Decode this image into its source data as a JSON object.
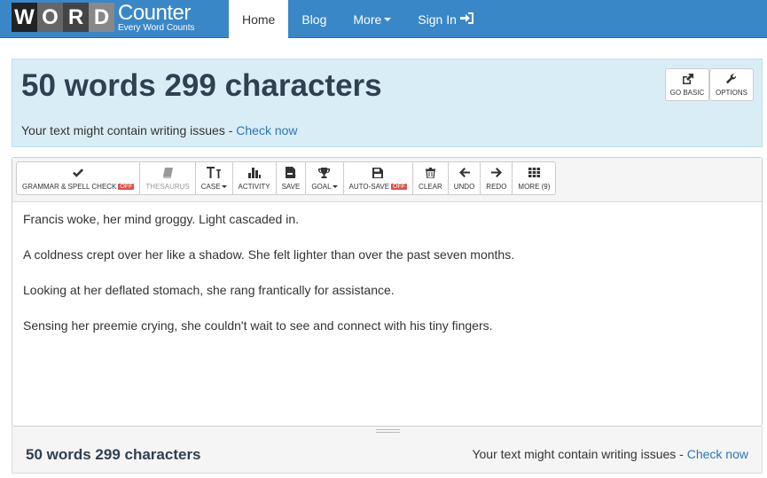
{
  "logo": {
    "letters": [
      "W",
      "O",
      "R",
      "D"
    ],
    "main": "Counter",
    "sub": "Every Word Counts"
  },
  "nav": {
    "home": "Home",
    "blog": "Blog",
    "more": "More",
    "signin": "Sign In"
  },
  "stats": {
    "title": "50 words 299 characters",
    "issues_prefix": "Your text might contain writing issues - ",
    "issues_link": "Check now",
    "go_basic": "GO BASIC",
    "options": "OPTIONS"
  },
  "toolbar": {
    "grammar": "GRAMMAR & SPELL CHECK",
    "grammar_badge": "OFF",
    "thesaurus": "THESAURUS",
    "case": "CASE",
    "activity": "ACTIVITY",
    "save": "SAVE",
    "goal": "GOAL",
    "autosave": "AUTO-SAVE",
    "autosave_badge": "OFF",
    "clear": "CLEAR",
    "undo": "UNDO",
    "redo": "REDO",
    "more": "MORE (9)"
  },
  "editor": {
    "paragraphs": [
      "Francis woke, her mind groggy. Light cascaded in.",
      "A coldness crept over her like a shadow.  She felt lighter than over the past seven months.",
      "Looking at her deflated stomach, she rang frantically for assistance.",
      "Sensing her preemie crying, she couldn't wait to see and connect with his tiny fingers."
    ]
  },
  "footer": {
    "title": "50 words 299 characters",
    "issues_prefix": "Your text might contain writing issues - ",
    "issues_link": "Check now"
  }
}
